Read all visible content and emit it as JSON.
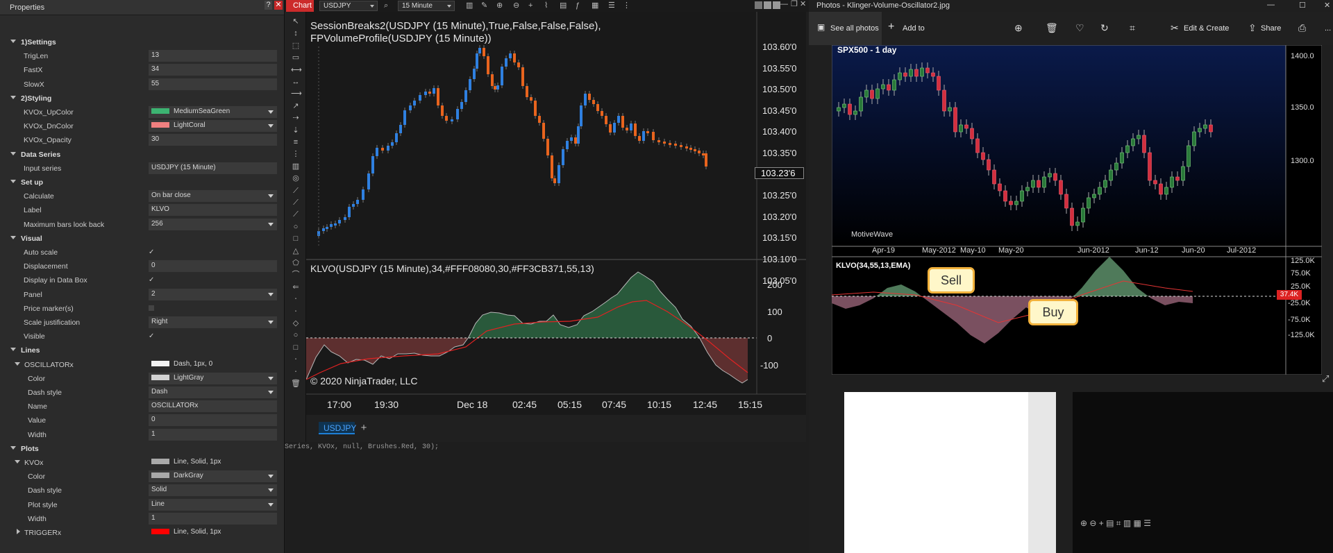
{
  "properties": {
    "title": "Properties",
    "rows": [
      {
        "type": "cat",
        "label": "1)Settings"
      },
      {
        "type": "prop",
        "label": "TrigLen",
        "value": "13"
      },
      {
        "type": "prop",
        "label": "FastX",
        "value": "34"
      },
      {
        "type": "prop",
        "label": "SlowX",
        "value": "55"
      },
      {
        "type": "cat",
        "label": "2)Styling"
      },
      {
        "type": "prop",
        "label": "KVOx_UpColor",
        "value": "MediumSeaGreen",
        "swatch": "#3cb371",
        "dropdown": true
      },
      {
        "type": "prop",
        "label": "KVOx_DnColor",
        "value": "LightCoral",
        "swatch": "#f08080",
        "dropdown": true
      },
      {
        "type": "prop",
        "label": "KVOx_Opacity",
        "value": "30"
      },
      {
        "type": "cat",
        "label": "Data Series"
      },
      {
        "type": "prop",
        "label": "Input series",
        "value": "USDJPY (15 Minute)"
      },
      {
        "type": "cat",
        "label": "Set up"
      },
      {
        "type": "prop",
        "label": "Calculate",
        "value": "On bar close",
        "dropdown": true
      },
      {
        "type": "prop",
        "label": "Label",
        "value": "KLVO"
      },
      {
        "type": "prop",
        "label": "Maximum bars look back",
        "value": "256",
        "dropdown": true
      },
      {
        "type": "cat",
        "label": "Visual"
      },
      {
        "type": "check",
        "label": "Auto scale",
        "checked": true
      },
      {
        "type": "prop",
        "label": "Displacement",
        "value": "0"
      },
      {
        "type": "check",
        "label": "Display in Data Box",
        "checked": true
      },
      {
        "type": "prop",
        "label": "Panel",
        "value": "2",
        "dropdown": true
      },
      {
        "type": "check",
        "label": "Price marker(s)",
        "checked": false
      },
      {
        "type": "prop",
        "label": "Scale justification",
        "value": "Right",
        "dropdown": true
      },
      {
        "type": "check",
        "label": "Visible",
        "checked": true
      },
      {
        "type": "cat",
        "label": "Lines"
      },
      {
        "type": "sub",
        "label": "OSCILLATORx",
        "value": "Dash, 1px, 0",
        "swatch": "#f2f2f2",
        "open": true
      },
      {
        "type": "prop2",
        "label": "Color",
        "value": "LightGray",
        "swatch": "#d3d3d3",
        "dropdown": true
      },
      {
        "type": "prop2",
        "label": "Dash style",
        "value": "Dash",
        "dropdown": true
      },
      {
        "type": "prop2",
        "label": "Name",
        "value": "OSCILLATORx"
      },
      {
        "type": "prop2",
        "label": "Value",
        "value": "0"
      },
      {
        "type": "prop2",
        "label": "Width",
        "value": "1"
      },
      {
        "type": "cat",
        "label": "Plots"
      },
      {
        "type": "sub",
        "label": "KVOx",
        "value": "Line, Solid, 1px",
        "swatch": "#a9a9a9",
        "open": true
      },
      {
        "type": "prop2",
        "label": "Color",
        "value": "DarkGray",
        "swatch": "#a9a9a9",
        "dropdown": true
      },
      {
        "type": "prop2",
        "label": "Dash style",
        "value": "Solid",
        "dropdown": true
      },
      {
        "type": "prop2",
        "label": "Plot style",
        "value": "Line",
        "dropdown": true
      },
      {
        "type": "prop2",
        "label": "Width",
        "value": "1"
      },
      {
        "type": "sub",
        "label": "TRIGGERx",
        "value": "Line, Solid, 1px",
        "swatch": "#ff0000",
        "open": false
      }
    ]
  },
  "toolbar": {
    "chart_label": "Chart",
    "instrument": "USDJPY",
    "interval": "15 Minute"
  },
  "chart": {
    "price_title": "SessionBreaks2(USDJPY (15 Minute),True,False,False,False), FPVolumeProfile(USDJPY (15 Minute))",
    "osc_title": "KLVO(USDJPY (15 Minute),34,#FFF08080,30,#FF3CB371,55,13)",
    "copyright": "© 2020 NinjaTrader, LLC",
    "price_ticks": [
      "103.60'0",
      "103.55'0",
      "103.50'0",
      "103.45'0",
      "103.40'0",
      "103.35'0",
      "103.30'0",
      "103.25'0",
      "103.20'0",
      "103.15'0",
      "103.10'0",
      "103.05'0"
    ],
    "last_price": "103.23'6",
    "osc_ticks": [
      "200",
      "100",
      "0",
      "-100"
    ],
    "time_ticks": [
      "17:00",
      "19:30",
      "Dec 18",
      "02:45",
      "05:15",
      "07:45",
      "10:15",
      "12:45",
      "15:15"
    ],
    "tab": "USDJPY",
    "tab_add": "+",
    "up_color": "#2f80e0",
    "down_color": "#e8641e"
  },
  "code_line": "Series, KVOx, null, Brushes.Red, 30);",
  "photos": {
    "window_title": "Photos - Klinger-Volume-Oscillator2.jpg",
    "see_all": "See all photos",
    "add_to": "Add to",
    "edit_create": "Edit & Create",
    "share": "Share",
    "more": "...",
    "image": {
      "symbol": "SPX500 - 1 day",
      "watermark": "MotiveWave",
      "price_ticks": [
        "1400.0",
        "1350.0",
        "1300.0"
      ],
      "date_ticks": [
        "Apr-19",
        "May-2012",
        "May-10",
        "May-20",
        "Jun-2012",
        "Jun-12",
        "Jun-20",
        "Jul-2012"
      ],
      "osc_label": "KLVO(34,55,13,EMA)",
      "osc_ticks": [
        "125.0K",
        "75.0K",
        "25.0K",
        "-25.0K",
        "-75.0K",
        "-125.0K"
      ],
      "osc_marker": "37.4K",
      "sell": "Sell",
      "buy": "Buy"
    }
  }
}
